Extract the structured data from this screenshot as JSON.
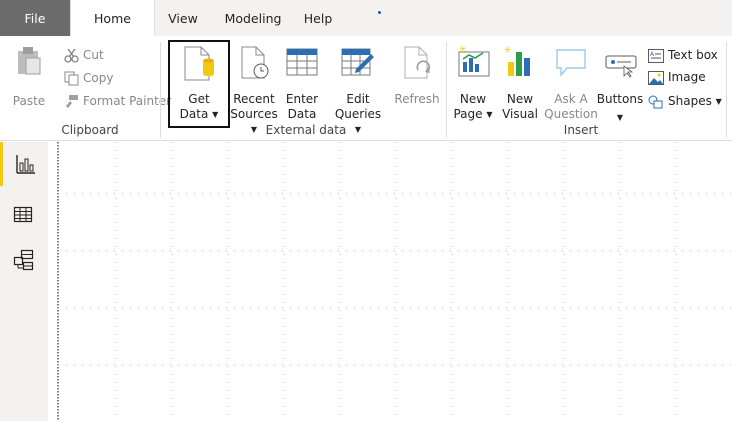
{
  "tabs": {
    "file": "File",
    "home": "Home",
    "view": "View",
    "modeling": "Modeling",
    "help": "Help"
  },
  "clipboard": {
    "paste": "Paste",
    "cut": "Cut",
    "copy": "Copy",
    "format_painter": "Format Painter",
    "group_label": "Clipboard"
  },
  "external_data": {
    "get_data": [
      "Get",
      "Data"
    ],
    "recent_sources": [
      "Recent",
      "Sources"
    ],
    "enter_data": [
      "Enter",
      "Data"
    ],
    "edit_queries": [
      "Edit",
      "Queries"
    ],
    "refresh": "Refresh",
    "group_label": "External data"
  },
  "insert": {
    "new_page": [
      "New",
      "Page"
    ],
    "new_visual": [
      "New",
      "Visual"
    ],
    "ask_a_question": [
      "Ask A",
      "Question"
    ],
    "buttons": "Buttons",
    "text_box": "Text box",
    "image": "Image",
    "shapes": "Shapes",
    "group_label": "Insert"
  },
  "colors": {
    "accent_yellow": "#f2c811",
    "file_tab": "#6b6b6b",
    "ribbon_bg": "#ffffff",
    "rail_bg": "#f3f2f1"
  }
}
